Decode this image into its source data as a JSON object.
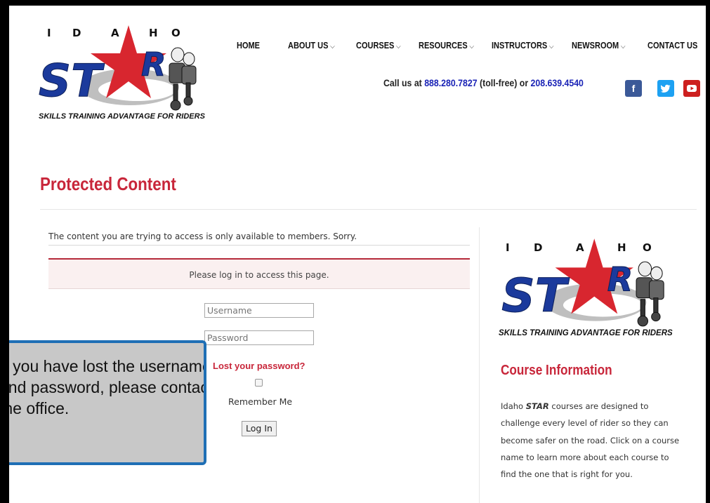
{
  "header": {
    "logo": {
      "idaho_letters": "I D A H O",
      "star_text": "STAR",
      "tagline": "SKILLS TRAINING ADVANTAGE FOR RIDERS"
    },
    "nav": [
      {
        "label": "HOME",
        "has_dropdown": false
      },
      {
        "label": "ABOUT US",
        "has_dropdown": true
      },
      {
        "label": "COURSES",
        "has_dropdown": true
      },
      {
        "label": "RESOURCES",
        "has_dropdown": true
      },
      {
        "label": "INSTRUCTORS",
        "has_dropdown": true
      },
      {
        "label": "NEWSROOM",
        "has_dropdown": true
      },
      {
        "label": "CONTACT US",
        "has_dropdown": false
      }
    ],
    "call": {
      "prefix": "Call us at ",
      "phone1": "888.280.7827",
      "middle": " (toll-free) or ",
      "phone2": "208.639.4540"
    },
    "social": [
      {
        "icon": "facebook-icon",
        "glyph": "f",
        "color": "#3b5998"
      },
      {
        "icon": "twitter-icon",
        "glyph": "t",
        "color": "#1da1f2"
      },
      {
        "icon": "youtube-icon",
        "glyph": "▶",
        "color": "#cd201f"
      }
    ]
  },
  "main": {
    "title": "Protected Content",
    "message": "The content you are trying to access is only available to members. Sorry.",
    "alert": "Please log in to access this page.",
    "username_placeholder": "Username",
    "password_placeholder": "Password",
    "lost_password": "Lost your password?",
    "remember_me": "Remember Me",
    "login_button": "Log In"
  },
  "sidebar": {
    "logo": {
      "idaho_letters": "I D A H O",
      "star_text": "STAR",
      "tagline": "SKILLS TRAINING ADVANTAGE FOR RIDERS"
    },
    "course_title": "Course Information",
    "course_text_pre": "Idaho ",
    "course_text_brand": "STAR",
    "course_text_post": " courses are designed to challenge every level of rider so they can become safer on the road. Click on a course name to learn more about each course to find the one that is right for you."
  },
  "callout": {
    "text": "If you have lost the username and password, please contact the office."
  },
  "colors": {
    "accent_red": "#c8263a",
    "phone_blue": "#1a23b6",
    "callout_border": "#1f6fb5",
    "star_blue": "#1b3a9c"
  }
}
